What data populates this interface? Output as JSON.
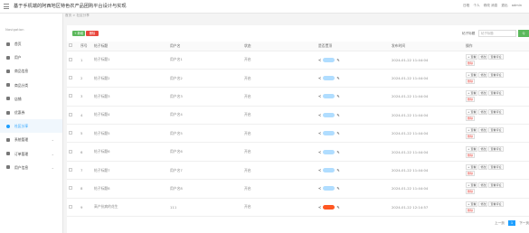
{
  "header": {
    "title": "基于手机端的阿西地区特色农产品团购平台设计与实现",
    "right_items": [
      "日程",
      "个人",
      "修改 消息",
      "退出"
    ],
    "user": "admin"
  },
  "sidebar": {
    "section_label": "Navigation",
    "items": [
      {
        "label": "首页",
        "icon": "home-icon",
        "chevron": false
      },
      {
        "label": "用户",
        "icon": "user-icon",
        "chevron": false
      },
      {
        "label": "商品信息",
        "icon": "grid-icon",
        "chevron": false
      },
      {
        "label": "商品分类",
        "icon": "grid-icon",
        "chevron": false
      },
      {
        "label": "店铺",
        "icon": "store-icon",
        "chevron": false
      },
      {
        "label": "优惠券",
        "icon": "ticket-icon",
        "chevron": false
      },
      {
        "label": "社区分享",
        "icon": "share-icon",
        "chevron": false,
        "active": true
      },
      {
        "label": "系统管理",
        "icon": "grid-icon",
        "chevron": true
      },
      {
        "label": "订单管理",
        "icon": "grid-icon",
        "chevron": true
      },
      {
        "label": "用户信息",
        "icon": "grid-icon",
        "chevron": true
      }
    ]
  },
  "breadcrumb": "首页 > 社区分享",
  "toolbar": {
    "add_label": "+ 新增",
    "delete_label": "删除",
    "search_label": "帖子标题",
    "search_placeholder": "帖子标题",
    "search_button": "Q"
  },
  "table": {
    "headers": [
      "",
      "序号",
      "帖子标题",
      "用户名",
      "状态",
      "是否置顶",
      "发布时间",
      "操作"
    ],
    "rows": [
      {
        "no": "1",
        "title": "帖子标题1",
        "user": "用户名1",
        "status": "开启",
        "time": "2024-01-22 11:44:04"
      },
      {
        "no": "2",
        "title": "帖子标题2",
        "user": "用户名2",
        "status": "开启",
        "time": "2024-01-22 11:44:04"
      },
      {
        "no": "3",
        "title": "帖子标题3",
        "user": "用户名3",
        "status": "开启",
        "time": "2024-01-22 11:44:04"
      },
      {
        "no": "4",
        "title": "帖子标题4",
        "user": "用户名4",
        "status": "开启",
        "time": "2024-01-22 11:44:04"
      },
      {
        "no": "5",
        "title": "帖子标题5",
        "user": "用户名5",
        "status": "开启",
        "time": "2024-01-22 11:44:04"
      },
      {
        "no": "6",
        "title": "帖子标题6",
        "user": "用户名6",
        "status": "开启",
        "time": "2024-01-22 11:44:04"
      },
      {
        "no": "7",
        "title": "帖子标题7",
        "user": "用户名7",
        "status": "开启",
        "time": "2024-01-22 11:44:04"
      },
      {
        "no": "8",
        "title": "帖子标题8",
        "user": "用户名8",
        "status": "开启",
        "time": "2024-01-22 11:44:04"
      },
      {
        "no": "9",
        "title": "高产抗病的花生",
        "user": "111",
        "status": "开启",
        "time": "2024-01-22 12:14:57"
      }
    ],
    "op_labels": [
      "+ 查看",
      "修改",
      "查看评论",
      "删除"
    ]
  },
  "pager": {
    "prev": "上一页",
    "current": "1",
    "next": "下一页"
  },
  "colors": {
    "primary": "#1e9fff",
    "success": "#5cb85c",
    "danger": "#e8453c",
    "active_toggle": "#ff5722"
  }
}
